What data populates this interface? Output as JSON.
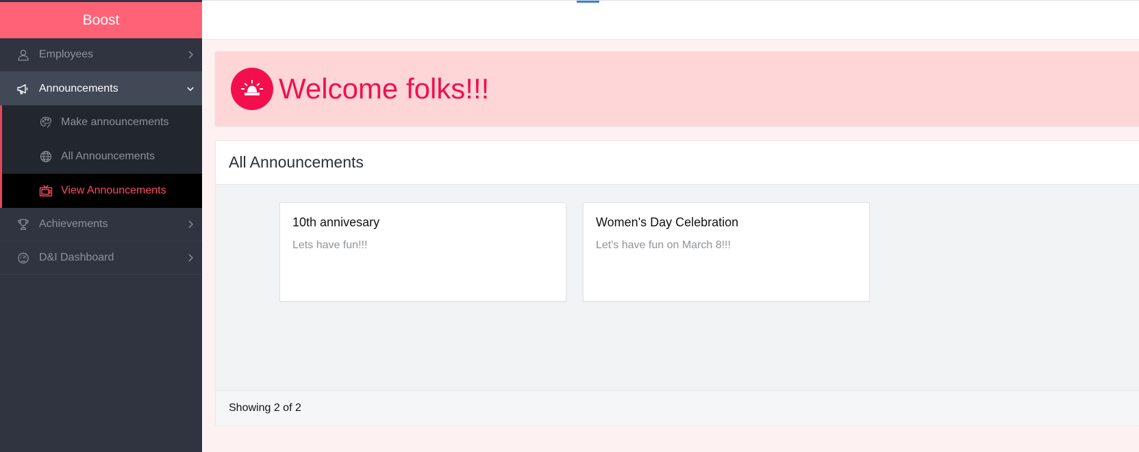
{
  "app": {
    "brand": "Boost"
  },
  "sidebar": {
    "items": [
      {
        "label": "Employees",
        "icon": "user-icon"
      },
      {
        "label": "Announcements",
        "icon": "megaphone-icon",
        "expanded": true,
        "children": [
          {
            "label": "Make announcements",
            "icon": "palette-icon"
          },
          {
            "label": "All Announcements",
            "icon": "globe-icon"
          },
          {
            "label": "View Announcements",
            "icon": "tv-icon",
            "active": true
          }
        ]
      },
      {
        "label": "Achievements",
        "icon": "trophy-icon"
      },
      {
        "label": "D&I Dashboard",
        "icon": "dashboard-icon"
      }
    ]
  },
  "welcome": {
    "title": "Welcome folks!!!",
    "icon": "siren-icon"
  },
  "panel": {
    "title": "All Announcements",
    "cards": [
      {
        "title": "10th annivesary",
        "description": "Lets have fun!!!"
      },
      {
        "title": "Women's Day Celebration",
        "description": "Let's have fun on March 8!!!"
      }
    ],
    "footer": "Showing 2 of 2"
  },
  "colors": {
    "brand": "#fe6277",
    "sidebar_bg": "#2f3440",
    "accent": "#f30f4d",
    "active_text": "#fe4a63",
    "welcome_bg": "#fed6d8"
  }
}
